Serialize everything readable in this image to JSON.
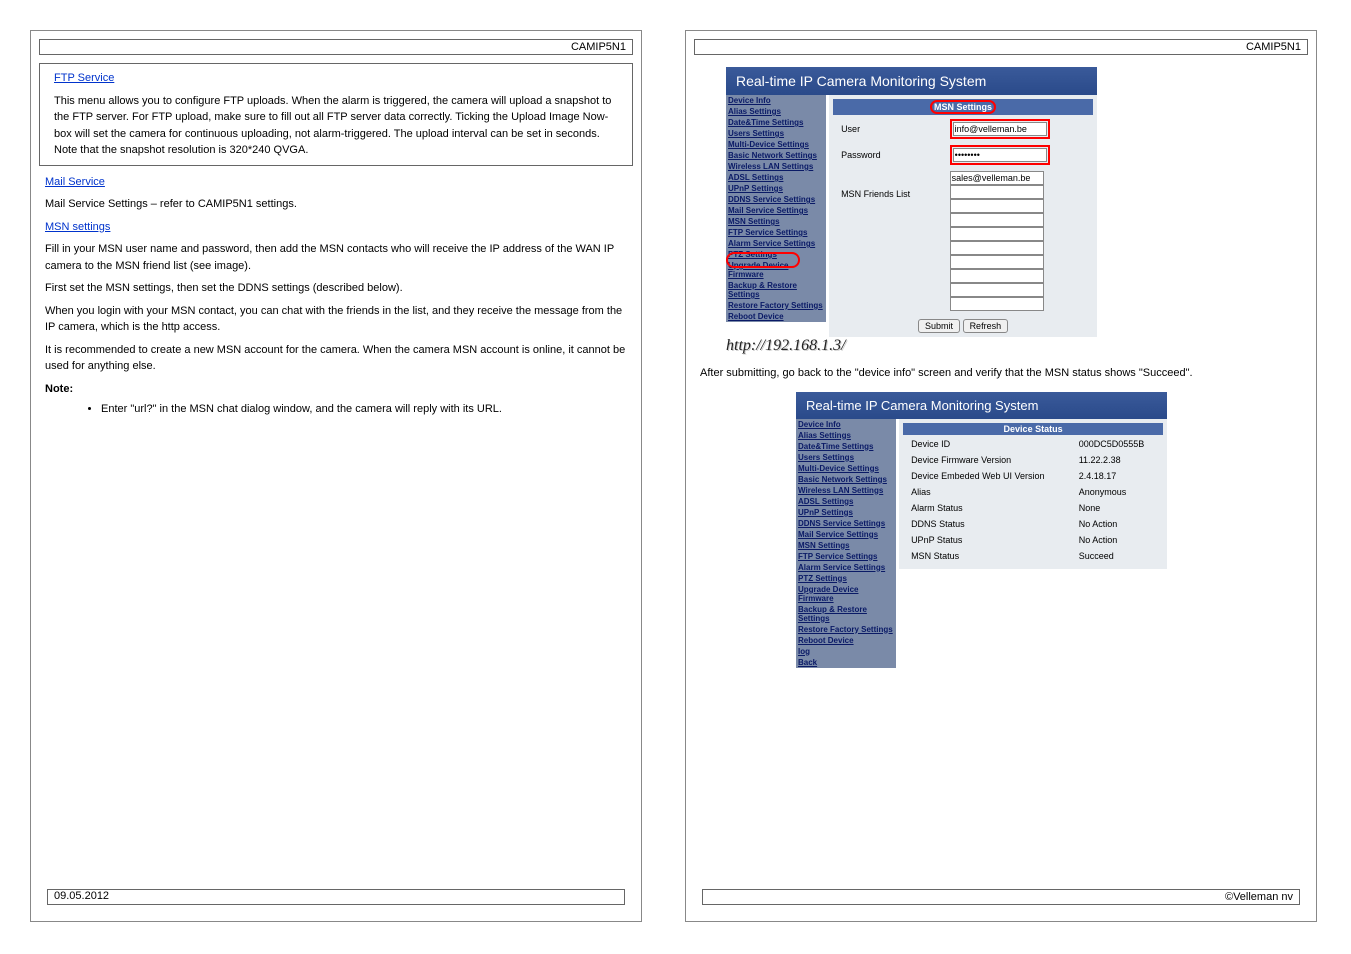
{
  "left": {
    "top_title": "CAMIP5N1",
    "box1_heading": "FTP Service",
    "box1_text": "This menu allows you to configure FTP uploads. When the alarm is triggered, the camera will upload a snapshot to the FTP server. For FTP upload, make sure to fill out all FTP server data correctly. Ticking the Upload Image Now-box will set the camera for continuous uploading, not alarm-triggered. The upload interval can be set in seconds. Note that the snapshot resolution is 320*240 QVGA.",
    "mail_heading": "Mail Service",
    "mail_text": "Mail Service Settings – refer to CAMIP5N1 settings.",
    "msn_heading": "MSN settings",
    "msn_text1": "Fill in your MSN user name and password, then add the MSN contacts who will receive the IP address of the WAN IP camera to the MSN friend list (see image).",
    "msn_text2": "First set the MSN settings, then set the DDNS settings (described below).",
    "msn_text3": "When you login with your MSN contact, you can chat with the friends in the list, and they receive the message from the IP camera, which is the http access.",
    "msn_text4": "It is recommended to create a new MSN account for the camera. When the camera MSN account is online, it cannot be used for anything else.",
    "note_heading": "Note:",
    "bullet": "Enter \"url?\" in the MSN chat dialog window, and the camera will reply with its URL.",
    "footer": "09.05.2012"
  },
  "right": {
    "top_title": "CAMIP5N1",
    "shot1": {
      "banner": "Real-time IP Camera Monitoring System",
      "menu": [
        "Device Info",
        "Alias Settings",
        "Date&Time Settings",
        "Users Settings",
        "Multi-Device Settings",
        "Basic Network Settings",
        "Wireless LAN Settings",
        "ADSL Settings",
        "UPnP Settings",
        "DDNS Service Settings",
        "Mail Service Settings",
        "MSN Settings",
        "FTP Service Settings",
        "Alarm Service Settings",
        "PTZ Settings",
        "Upgrade Device Firmware",
        "Backup & Restore Settings",
        "Restore Factory Settings",
        "Reboot Device"
      ],
      "panel_title": "MSN Settings",
      "user_label": "User",
      "user_val": "info@velleman.be",
      "pass_label": "Password",
      "pass_val": "••••••••",
      "friends_label": "MSN Friends List",
      "friend1": "sales@velleman.be",
      "submit": "Submit",
      "refresh": "Refresh",
      "url": "http://192.168.1.3/"
    },
    "mid_text": "After submitting, go back to the \"device info\" screen and verify that the MSN status shows \"Succeed\".",
    "shot2": {
      "banner": "Real-time IP Camera Monitoring System",
      "menu": [
        "Device Info",
        "Alias Settings",
        "Date&Time Settings",
        "Users Settings",
        "Multi-Device Settings",
        "Basic Network Settings",
        "Wireless LAN Settings",
        "ADSL Settings",
        "UPnP Settings",
        "DDNS Service Settings",
        "Mail Service Settings",
        "MSN Settings",
        "FTP Service Settings",
        "Alarm Service Settings",
        "PTZ Settings",
        "Upgrade Device Firmware",
        "Backup & Restore Settings",
        "Restore Factory Settings",
        "Reboot Device",
        "log",
        "Back"
      ],
      "panel_title": "Device Status",
      "rows": [
        [
          "Device ID",
          "000DC5D0555B"
        ],
        [
          "Device Firmware Version",
          "11.22.2.38"
        ],
        [
          "Device Embeded Web UI Version",
          "2.4.18.17"
        ],
        [
          "Alias",
          "Anonymous"
        ],
        [
          "Alarm Status",
          "None"
        ],
        [
          "DDNS Status",
          "No Action"
        ],
        [
          "UPnP Status",
          "No Action"
        ],
        [
          "MSN Status",
          "Succeed"
        ]
      ]
    },
    "footer": "©Velleman nv"
  }
}
